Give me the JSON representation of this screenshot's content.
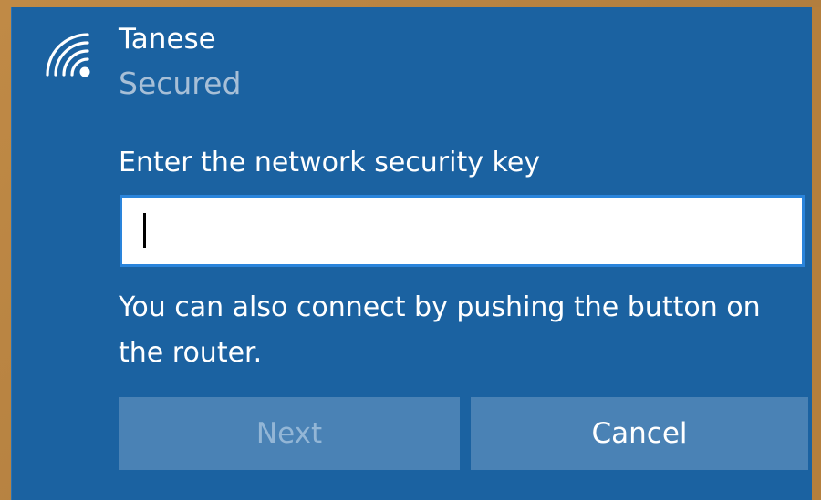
{
  "network": {
    "icon": "wifi-secured-icon",
    "name": "Tanese",
    "status": "Secured"
  },
  "security": {
    "prompt": "Enter the network security key",
    "key_value": "",
    "hint": "You can also connect by pushing the button on the router."
  },
  "buttons": {
    "next_label": "Next",
    "cancel_label": "Cancel"
  },
  "colors": {
    "panel_background": "#1b62a1",
    "input_border": "#2a84db",
    "button_background": "#4a82b5",
    "secondary_text": "#a7bfd7"
  }
}
